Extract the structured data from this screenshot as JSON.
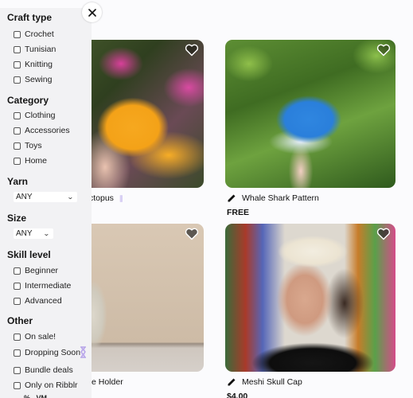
{
  "filters": {
    "close_label": "×",
    "sections": [
      {
        "title": "Craft type",
        "options": [
          "Crochet",
          "Tunisian",
          "Knitting",
          "Sewing"
        ]
      },
      {
        "title": "Category",
        "options": [
          "Clothing",
          "Accessories",
          "Toys",
          "Home"
        ]
      },
      {
        "title": "Yarn",
        "select": "ANY"
      },
      {
        "title": "Size",
        "select": "ANY"
      },
      {
        "title": "Skill level",
        "options": [
          "Beginner",
          "Intermediate",
          "Advanced"
        ]
      },
      {
        "title": "Other",
        "options": [
          "On sale!",
          "Dropping Soon",
          "Bundle deals",
          "Only on Ribblr"
        ]
      }
    ],
    "cut_off_text": "%   VM"
  },
  "products": [
    {
      "title": "Octopus",
      "visible_title": "ctopus",
      "price": "",
      "image": "orange-crochet-octopus",
      "favorited": false,
      "type_icon": "pattern-pen-icon"
    },
    {
      "title": "Whale Shark Pattern",
      "price": "FREE",
      "image": "blue-crochet-whale-shark",
      "favorited": false,
      "type_icon": "pattern-pen-icon"
    },
    {
      "title": "Holder",
      "visible_title": "e Holder",
      "price": "",
      "image": "crochet-bottle-holders",
      "favorited": false,
      "type_icon": "pattern-pen-icon"
    },
    {
      "title": "Meshi Skull Cap",
      "price": "$4.00",
      "image": "crochet-mesh-skull-cap",
      "favorited": false,
      "type_icon": "pattern-pen-icon"
    }
  ],
  "colors": {
    "sidebar_bg": "#f2f2f4",
    "page_bg": "#fbfbfd",
    "sticker": "#b8a6e8"
  }
}
